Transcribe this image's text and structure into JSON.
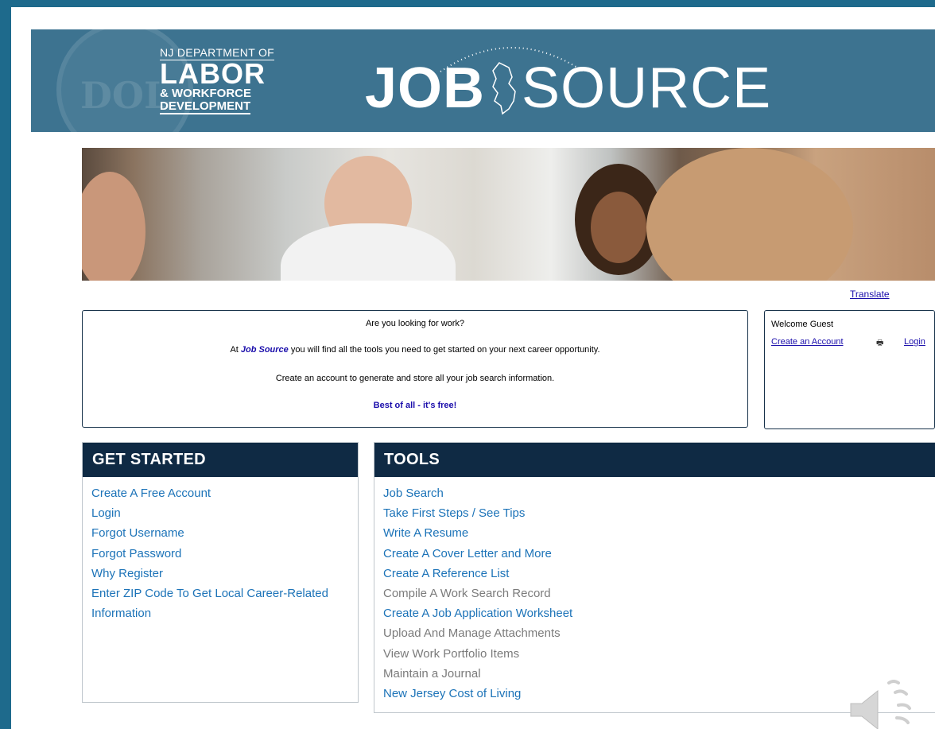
{
  "header": {
    "dept_line1": "NJ DEPARTMENT OF",
    "dept_line2": "LABOR",
    "dept_line3": "& WORKFORCE",
    "dept_line4": "DEVELOPMENT",
    "logo_job": "JOB",
    "logo_source": "SOURCE",
    "seal_text": "DOL"
  },
  "translate_link": "Translate",
  "intro": {
    "question": "Are you looking for work?",
    "line2_prefix": "At ",
    "line2_brand": "Job Source",
    "line2_suffix": " you will find all the tools you need to get started on your next career opportunity.",
    "line3": "Create an account to generate and store all your job search information.",
    "line4": "Best of all - it's free!"
  },
  "welcome": {
    "greeting": "Welcome Guest",
    "create_account": "Create an Account",
    "login": "Login",
    "printer_icon": "printer-icon"
  },
  "get_started": {
    "title": "GET STARTED",
    "items": [
      "Create A Free Account",
      "Login",
      "Forgot Username",
      "Forgot Password",
      "Why Register",
      "Enter ZIP Code To Get Local Career-Related",
      "Information"
    ]
  },
  "tools": {
    "title": "TOOLS",
    "items": [
      {
        "label": "Job Search",
        "enabled": true
      },
      {
        "label": "Take First Steps / See Tips",
        "enabled": true
      },
      {
        "label": "Write A Resume",
        "enabled": true
      },
      {
        "label": "Create A Cover Letter and More",
        "enabled": true
      },
      {
        "label": "Create A Reference List",
        "enabled": true
      },
      {
        "label": "Compile A Work Search Record",
        "enabled": false
      },
      {
        "label": "Create A Job Application Worksheet",
        "enabled": true
      },
      {
        "label": "Upload And Manage Attachments",
        "enabled": false
      },
      {
        "label": "View Work Portfolio Items",
        "enabled": false
      },
      {
        "label": "Maintain a Journal",
        "enabled": false
      },
      {
        "label": "New Jersey Cost of Living",
        "enabled": true
      }
    ]
  },
  "colors": {
    "frame": "#1e6a8c",
    "banner": "#3d7390",
    "panel_header": "#0f2a44",
    "link": "#1c73b8",
    "disabled": "#7b7b7b"
  }
}
